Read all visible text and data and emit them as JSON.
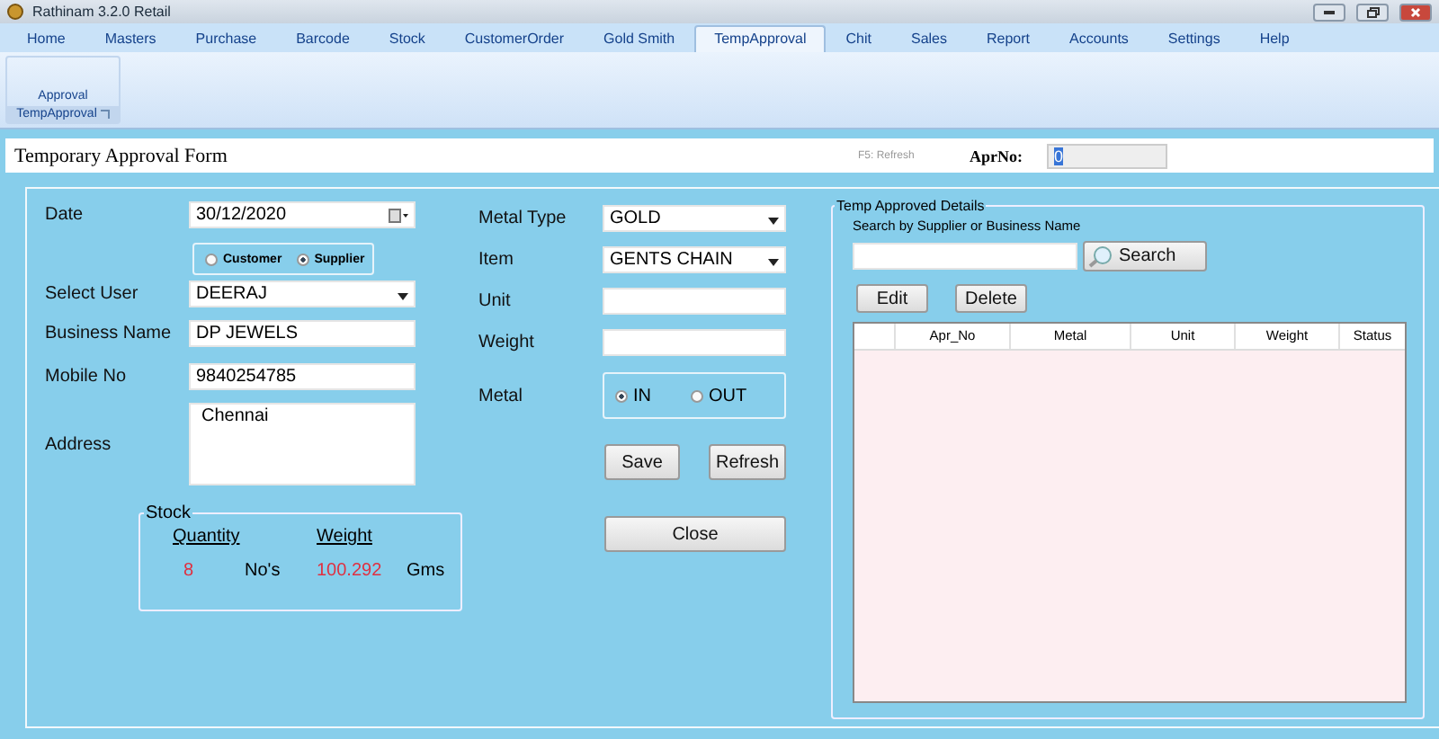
{
  "window": {
    "title": "Rathinam 3.2.0 Retail"
  },
  "menu_tabs": [
    {
      "label": "Home",
      "selected": false
    },
    {
      "label": "Masters",
      "selected": false
    },
    {
      "label": "Purchase",
      "selected": false
    },
    {
      "label": "Barcode",
      "selected": false
    },
    {
      "label": "Stock",
      "selected": false
    },
    {
      "label": "CustomerOrder",
      "selected": false
    },
    {
      "label": "Gold Smith",
      "selected": false
    },
    {
      "label": "TempApproval",
      "selected": true
    },
    {
      "label": "Chit",
      "selected": false
    },
    {
      "label": "Sales",
      "selected": false
    },
    {
      "label": "Report",
      "selected": false
    },
    {
      "label": "Accounts",
      "selected": false
    },
    {
      "label": "Settings",
      "selected": false
    },
    {
      "label": "Help",
      "selected": false
    }
  ],
  "ribbon": {
    "button": "Approval",
    "group": "TempApproval"
  },
  "form_header": {
    "title": "Temporary  Approval Form",
    "hint": "F5: Refresh",
    "apr_label": "AprNo:",
    "apr_value": "0"
  },
  "left_fields": [
    {
      "kind": "date",
      "label": "Date",
      "value": "30/12/2020"
    },
    {
      "kind": "radios",
      "options": [
        {
          "label": "Customer",
          "selected": false
        },
        {
          "label": "Supplier",
          "selected": true
        }
      ]
    },
    {
      "kind": "dropdown",
      "label": "Select User",
      "value": "DEERAJ"
    },
    {
      "kind": "text",
      "label": "Business Name",
      "value": "DP JEWELS"
    },
    {
      "kind": "text",
      "label": "Mobile No",
      "value": "9840254785"
    },
    {
      "kind": "area",
      "label": "Address",
      "value": "Chennai"
    }
  ],
  "stock": {
    "title": "Stock",
    "quantity_label": "Quantity",
    "weight_label": "Weight",
    "quantity": "8",
    "quantity_unit": "No's",
    "weight": "100.292",
    "weight_unit": "Gms"
  },
  "right_fields": [
    {
      "kind": "dropdown",
      "label": "Metal Type",
      "value": "GOLD"
    },
    {
      "kind": "dropdown",
      "label": "Item",
      "value": "GENTS CHAIN"
    },
    {
      "kind": "text",
      "label": "Unit"
    },
    {
      "kind": "text",
      "label": "Weight"
    },
    {
      "kind": "radios",
      "label": "Metal",
      "options": [
        {
          "label": "IN",
          "selected": true
        },
        {
          "label": "OUT",
          "selected": false
        }
      ]
    }
  ],
  "buttons": {
    "save": "Save",
    "refresh": "Refresh",
    "close": "Close"
  },
  "details": {
    "title": "Temp Approved Details",
    "search_label": "Search by  Supplier or Business Name",
    "search_button": "Search",
    "edit": "Edit",
    "delete": "Delete",
    "columns": [
      "Apr_No",
      "Metal",
      "Unit",
      "Weight",
      "Status"
    ]
  }
}
